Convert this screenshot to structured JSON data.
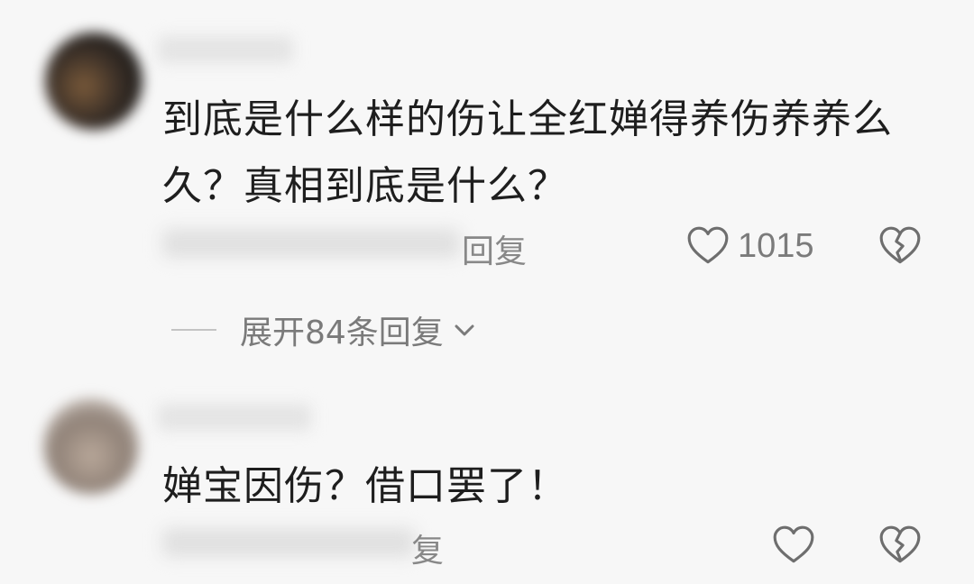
{
  "comments": [
    {
      "text_line1": "到底是什么样的伤让全红婵得养伤养养么",
      "text_line2": "久？真相到底是什么？",
      "reply_label": "回复",
      "like_count": "1015",
      "expand_replies": "展开84条回复"
    },
    {
      "text_line1": "婵宝因伤？借口罢了！",
      "reply_label": "复"
    }
  ],
  "icons": {
    "like": "heart-outline-icon",
    "dislike": "broken-heart-icon",
    "expand": "chevron-down-icon"
  },
  "colors": {
    "background": "#f7f7f7",
    "text": "#1e1e1e",
    "muted": "#7a7a7a"
  }
}
